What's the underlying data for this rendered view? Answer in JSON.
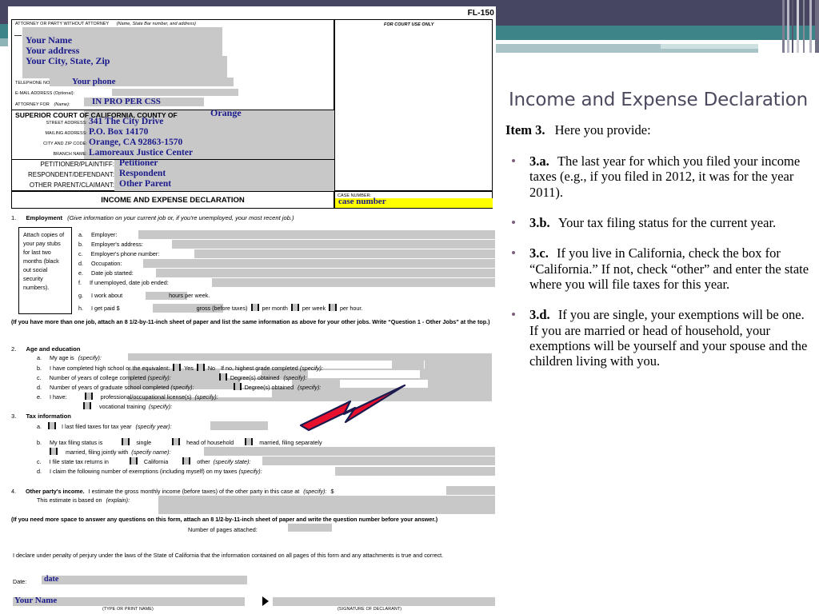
{
  "slide": {
    "title": "Income and Expense Declaration",
    "item_intro_label": "Item 3.",
    "item_intro_text": "Here you provide:",
    "bullets": [
      {
        "label": "3.a.",
        "text": "The last year for which you filed your income taxes (e.g., if you filed in 2012, it was for the year 2011)."
      },
      {
        "label": "3.b.",
        "text": "Your tax filing status for the current year."
      },
      {
        "label": "3.c.",
        "text": "If you live in California, check the box for “California.”  If not, check “other” and enter the state where you will file taxes for this year."
      },
      {
        "label": "3.d.",
        "text": "If you are single, your exemptions will be one.  If you are married or head of household, your exemptions will be yourself and your spouse and the children living with you."
      }
    ],
    "accent_color": "#3d8488",
    "header_dark": "#474661",
    "bullet_color": "#7d5f7d"
  },
  "form": {
    "form_number": "FL-150",
    "header": {
      "attorney_caption": "ATTORNEY OR PARTY WITHOUT ATTORNEY",
      "attorney_caption_italic": "(Name, State Bar number, and address)",
      "court_use_only": "FOR COURT USE ONLY",
      "name_value": "Your Name",
      "address_value": "Your address",
      "citystatezip_value": "Your City, State, Zip",
      "telephone_label": "TELEPHONE NO:",
      "telephone_value": "Your phone",
      "email_label": "E-MAIL ADDRESS (Optional):",
      "attorney_for_label": "ATTORNEY FOR",
      "attorney_for_label_italic": "(Name):",
      "attorney_for_value": "IN PRO PER   CSS",
      "court_line": "SUPERIOR COURT OF CALIFORNIA, COUNTY OF",
      "county_value": "Orange",
      "street_address_label": "STREET ADDRESS:",
      "street_address_value": "341 The City Drive",
      "mailing_address_label": "MAILING ADDRESS:",
      "mailing_address_value": "P.O. Box 14170",
      "city_zip_label": "CITY AND ZIP CODE:",
      "city_zip_value": "Orange, CA 92863-1570",
      "branch_name_label": "BRANCH NAME:",
      "branch_name_value": "Lamoreaux Justice Center",
      "petitioner_label": "PETITIONER/PLAINTIFF:",
      "petitioner_value": "Petitioner",
      "respondent_label": "RESPONDENT/DEFENDANT:",
      "respondent_value": "Respondent",
      "other_parent_label": "OTHER PARENT/CLAIMANT:",
      "other_parent_value": "Other Parent",
      "form_title": "INCOME AND EXPENSE DECLARATION",
      "case_number_label": "CASE NUMBER:",
      "case_number_value": "case number"
    },
    "item1": {
      "number": "1.",
      "title": "Employment",
      "instruction": "(Give information on your current job or, if you're unemployed, your most recent job.)",
      "sidenote": "Attach copies of your pay stubs for last two months (black out social security numbers).",
      "rows": [
        {
          "letter": "a.",
          "label": "Employer:"
        },
        {
          "letter": "b.",
          "label": "Employer's address:"
        },
        {
          "letter": "c.",
          "label": "Employer's phone number:"
        },
        {
          "letter": "d.",
          "label": "Occupation:"
        },
        {
          "letter": "e.",
          "label": "Date job started:"
        },
        {
          "letter": "f.",
          "label": "If unemployed, date job ended:"
        }
      ],
      "row_g": {
        "letter": "g.",
        "pre": "I work about",
        "post": "hours per week."
      },
      "row_h": {
        "letter": "h.",
        "pre": "I get paid $",
        "mid": "gross (before taxes)",
        "opt1": "per month",
        "opt2": "per week",
        "opt3": "per hour."
      },
      "footnote": "(If you have more than one job, attach an 8 1/2-by-11-inch sheet of paper and list the same information as above for your other jobs. Write “Question 1 - Other Jobs” at the top.)"
    },
    "item2": {
      "number": "2.",
      "title": "Age and education",
      "a": {
        "letter": "a.",
        "text": "My age is",
        "ital": "(specify):"
      },
      "b": {
        "letter": "b.",
        "text": "I have completed high school or the equivalent:",
        "yes": "Yes",
        "no": "No",
        "tail": "If no, highest grade completed",
        "tail_ital": "(specify):"
      },
      "c": {
        "letter": "c.",
        "text": "Number of years of college completed",
        "ital": "(specify):",
        "degree": "Degree(s) obtained",
        "degree_ital": "(specify):"
      },
      "d": {
        "letter": "d.",
        "text": "Number of years of graduate school completed",
        "ital": "(specify):",
        "degree": "Degree(s) obtained",
        "degree_ital": "(specify):"
      },
      "e": {
        "letter": "e.",
        "text": "I have:",
        "opt1": "professional/occupational license(s)",
        "opt1_ital": "(specify):",
        "opt2": "vocational training",
        "opt2_ital": "(specify):"
      }
    },
    "item3": {
      "number": "3.",
      "title": "Tax information",
      "a": {
        "letter": "a.",
        "text": "I last filed taxes for tax year",
        "ital": "(specify year):"
      },
      "b": {
        "letter": "b.",
        "text": "My tax filing status is",
        "o1": "single",
        "o2": "head of household",
        "o3": "married, filing separately",
        "o4": "married, filing jointly with",
        "o4_ital": "(specify name):"
      },
      "c": {
        "letter": "c.",
        "text": "I file state tax returns in",
        "o1": "California",
        "o2": "other",
        "o2_ital": "(specify state):"
      },
      "d": {
        "letter": "d.",
        "text": "I claim the following number of exemptions (including myself) on my taxes",
        "ital": "(specify):"
      }
    },
    "item4": {
      "number": "4.",
      "title": "Other party's income.",
      "text": "I estimate the gross monthly income (before taxes) of the other party in this case at",
      "ital": "(specify):",
      "dollar": "$",
      "line2": "This estimate is based on",
      "line2_ital": "(explain):"
    },
    "more_space_note": "(If you need more space to answer any questions on this form, attach an 8 1/2-by-11-inch sheet of paper and write the question number before your answer.)",
    "pages_attached_label": "Number of pages attached:",
    "declaration": "I declare under penalty of perjury under the laws of the State of California that the information contained on all pages of this form and any attachments is true and correct.",
    "date_label": "Date:",
    "date_value": "date",
    "signer_name": "Your Name",
    "type_print_name": "(TYPE OR PRINT NAME)",
    "signature_of_declarant": "(SIGNATURE OF DECLARANT)"
  }
}
